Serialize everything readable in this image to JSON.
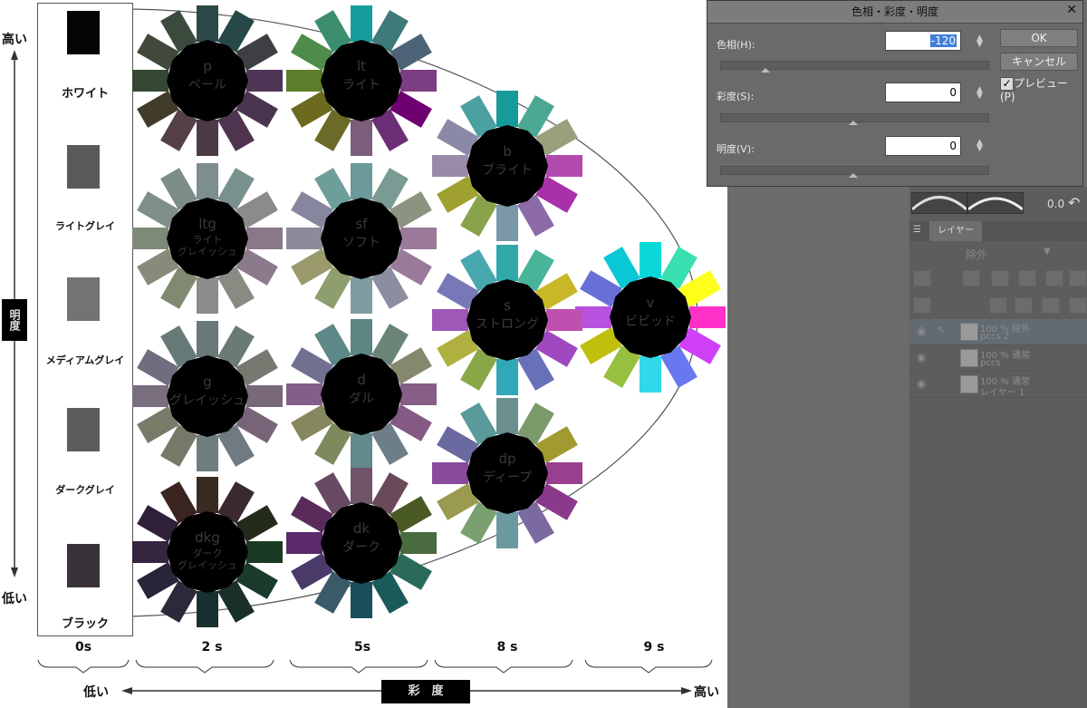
{
  "chart": {
    "axis_y_high": "高い",
    "axis_y_low": "低い",
    "axis_y_title": "明度",
    "axis_x_low": "低い",
    "axis_x_high": "高い",
    "axis_x_title": "彩　度",
    "saturation_levels": [
      "0s",
      "2 s",
      "5s",
      "8 s",
      "9 s"
    ]
  },
  "neutrals": [
    {
      "label": "ホワイト",
      "color": "#050505"
    },
    {
      "label": "ライトグレイ",
      "color": "#5a5a5a"
    },
    {
      "label": "メディアムグレイ",
      "color": "#737373"
    },
    {
      "label": "ダークグレイ",
      "color": "#5c5c5c"
    },
    {
      "label": "ブラック",
      "color": "#3a3239"
    }
  ],
  "tones": [
    {
      "code": "p",
      "name": "ペール",
      "colors": [
        "#2c4848",
        "#284848",
        "#3d3f45",
        "#4f3656",
        "#4a3551",
        "#4f344f",
        "#4b3b47",
        "#554048",
        "#413b2b",
        "#334733",
        "#414a3a",
        "#3a4a3d"
      ]
    },
    {
      "code": "lt",
      "name": "ライト",
      "colors": [
        "#169d9d",
        "#3e7a7a",
        "#4d6478",
        "#7d3d83",
        "#6e0070",
        "#6c2e77",
        "#7a5e7a",
        "#6b6a28",
        "#6c6a1f",
        "#5e7d2a",
        "#4d8c4a",
        "#3a8e6e"
      ]
    },
    {
      "code": "b",
      "name": "ブライト",
      "colors": [
        "#169a9a",
        "#4aa894",
        "#98a07c",
        "#b24ab0",
        "#a930a9",
        "#8c6ba8",
        "#7a98a8",
        "#88a24a",
        "#a0a030",
        "#9a8aa8",
        "#8a8aa8",
        "#4aa0a0"
      ]
    },
    {
      "code": "ltg",
      "name": "ライト\nグレイッシュ",
      "small": true,
      "colors": [
        "#7c8e8e",
        "#78908e",
        "#8c8a8a",
        "#8a788a",
        "#8b7a8b",
        "#8a8a82",
        "#8c8c8c",
        "#808a70",
        "#8a8a7a",
        "#7e8a78",
        "#7e8e88",
        "#7c8e86"
      ]
    },
    {
      "code": "sf",
      "name": "ソフト",
      "colors": [
        "#6c9a9a",
        "#7a9a94",
        "#8a9480",
        "#9a7a98",
        "#9a7a9a",
        "#8a8ea0",
        "#809ca0",
        "#8e9e6e",
        "#9a9a6c",
        "#8e8a9a",
        "#86869e",
        "#6e9e9a"
      ]
    },
    {
      "code": "v",
      "name": "ビビッド",
      "colors": [
        "#0ad8d8",
        "#38e0b0",
        "#ffff1c",
        "#ff30c8",
        "#d040f8",
        "#6878f0",
        "#30d8e8",
        "#98c040",
        "#c0c00c",
        "#b850e0",
        "#6870d8",
        "#08c8d8"
      ]
    },
    {
      "code": "s",
      "name": "ストロング",
      "colors": [
        "#30a8a8",
        "#48b498",
        "#c8b828",
        "#c050b0",
        "#a048c0",
        "#6870b8",
        "#30a8b8",
        "#88a848",
        "#b0b040",
        "#a058b8",
        "#7878b8",
        "#48a8b0"
      ]
    },
    {
      "code": "g",
      "name": "グレイッシュ",
      "colors": [
        "#6a7878",
        "#6a7a74",
        "#787870",
        "#786878",
        "#786478",
        "#707a80",
        "#6e7e7c",
        "#787868",
        "#7a7a68",
        "#786e7e",
        "#6e6e7e",
        "#687a78"
      ]
    },
    {
      "code": "d",
      "name": "ダル",
      "colors": [
        "#5e8484",
        "#6a8478",
        "#86886e",
        "#865e86",
        "#845a84",
        "#6e7e88",
        "#628a8a",
        "#7e8a5e",
        "#868660",
        "#845e8a",
        "#707090",
        "#5e8888"
      ]
    },
    {
      "code": "dp",
      "name": "ディープ",
      "colors": [
        "#6a9090",
        "#7a9a6a",
        "#a09a30",
        "#9a4090",
        "#8a3a8a",
        "#7a6aa0",
        "#6a9aa0",
        "#7aa070",
        "#9a9a50",
        "#8a4a9a",
        "#6a6aa0",
        "#5a9a9a"
      ]
    },
    {
      "code": "dkg",
      "name": "ダーク\nグレイッシュ",
      "small": true,
      "colors": [
        "#3a2a24",
        "#3a2a30",
        "#242a1a",
        "#1a3a24",
        "#1a3a2a",
        "#1a2e2a",
        "#183030",
        "#2a2a3a",
        "#2a2438",
        "#342440",
        "#30203a",
        "#3a2420"
      ]
    },
    {
      "code": "dk",
      "name": "ダーク",
      "colors": [
        "#70546a",
        "#6a4a5a",
        "#4a5a24",
        "#4a6a40",
        "#2a6a58",
        "#1a5a5a",
        "#1a4e5a",
        "#3a5a6a",
        "#4a3a6a",
        "#5a2a6a",
        "#5a2a5a",
        "#684a62"
      ]
    }
  ],
  "dialog": {
    "title": "色相・彩度・明度",
    "hue_label": "色相(H):",
    "hue_value": "-120",
    "sat_label": "彩度(S):",
    "sat_value": "0",
    "val_label": "明度(V):",
    "val_value": "0",
    "ok": "OK",
    "cancel": "キャンセル",
    "preview": "プレビュー(P)"
  },
  "layers_panel": {
    "tab": "レイヤー",
    "blend_mode": "除外",
    "opacity": "0.0",
    "layers": [
      {
        "line1": "100 % 除外",
        "line2": "pccs 2"
      },
      {
        "line1": "100 % 通常",
        "line2": "pccs"
      },
      {
        "line1": "100 % 通常",
        "line2": "レイヤー 1"
      }
    ]
  }
}
